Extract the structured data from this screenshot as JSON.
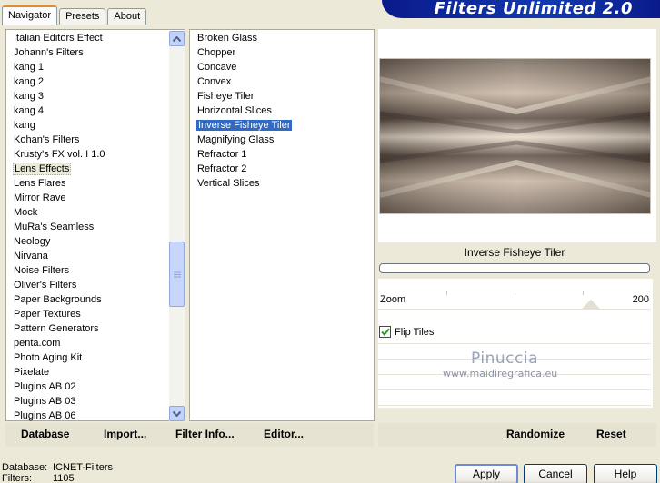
{
  "tabs": [
    "Navigator",
    "Presets",
    "About"
  ],
  "banner": {
    "title": "Filters Unlimited 2.0"
  },
  "categories": {
    "items": [
      "Italian Editors Effect",
      "Johann's Filters",
      "kang 1",
      "kang 2",
      "kang 3",
      "kang 4",
      "kang",
      "Kohan's Filters",
      "Krusty's FX vol. I 1.0",
      "Lens Effects",
      "Lens Flares",
      "Mirror Rave",
      "Mock",
      "MuRa's Seamless",
      "Neology",
      "Nirvana",
      "Noise Filters",
      "Oliver's Filters",
      "Paper Backgrounds",
      "Paper Textures",
      "Pattern Generators",
      "penta.com",
      "Photo Aging Kit",
      "Pixelate",
      "Plugins AB 02",
      "Plugins AB 03",
      "Plugins AB 06"
    ],
    "selected": "Lens Effects"
  },
  "filters": {
    "items": [
      "Broken Glass",
      "Chopper",
      "Concave",
      "Convex",
      "Fisheye Tiler",
      "Horizontal Slices",
      "Inverse Fisheye Tiler",
      "Magnifying Glass",
      "Refractor 1",
      "Refractor 2",
      "Vertical Slices"
    ],
    "selected": "Inverse Fisheye Tiler"
  },
  "preview": {
    "filter_name": "Inverse Fisheye Tiler"
  },
  "params": {
    "zoom_label": "Zoom",
    "zoom_value": "200",
    "flip_tiles_label": "Flip Tiles",
    "flip_tiles_checked": true
  },
  "watermark": {
    "name": "Pinuccia",
    "url": "www.maidiregrafica.eu"
  },
  "buttons_left": {
    "database": "Database",
    "import": "Import...",
    "filter_info": "Filter Info...",
    "editor": "Editor..."
  },
  "buttons_right": {
    "randomize": "Randomize",
    "reset": "Reset"
  },
  "status": {
    "database_label": "Database:",
    "database_value": "ICNET-Filters",
    "filters_label": "Filters:",
    "filters_value": "1105"
  },
  "dialog": {
    "apply": "Apply",
    "cancel": "Cancel",
    "help": "Help"
  },
  "colors": {
    "selection": "#316ac5",
    "banner": "#0a1a8a",
    "window": "#ece9d8"
  }
}
